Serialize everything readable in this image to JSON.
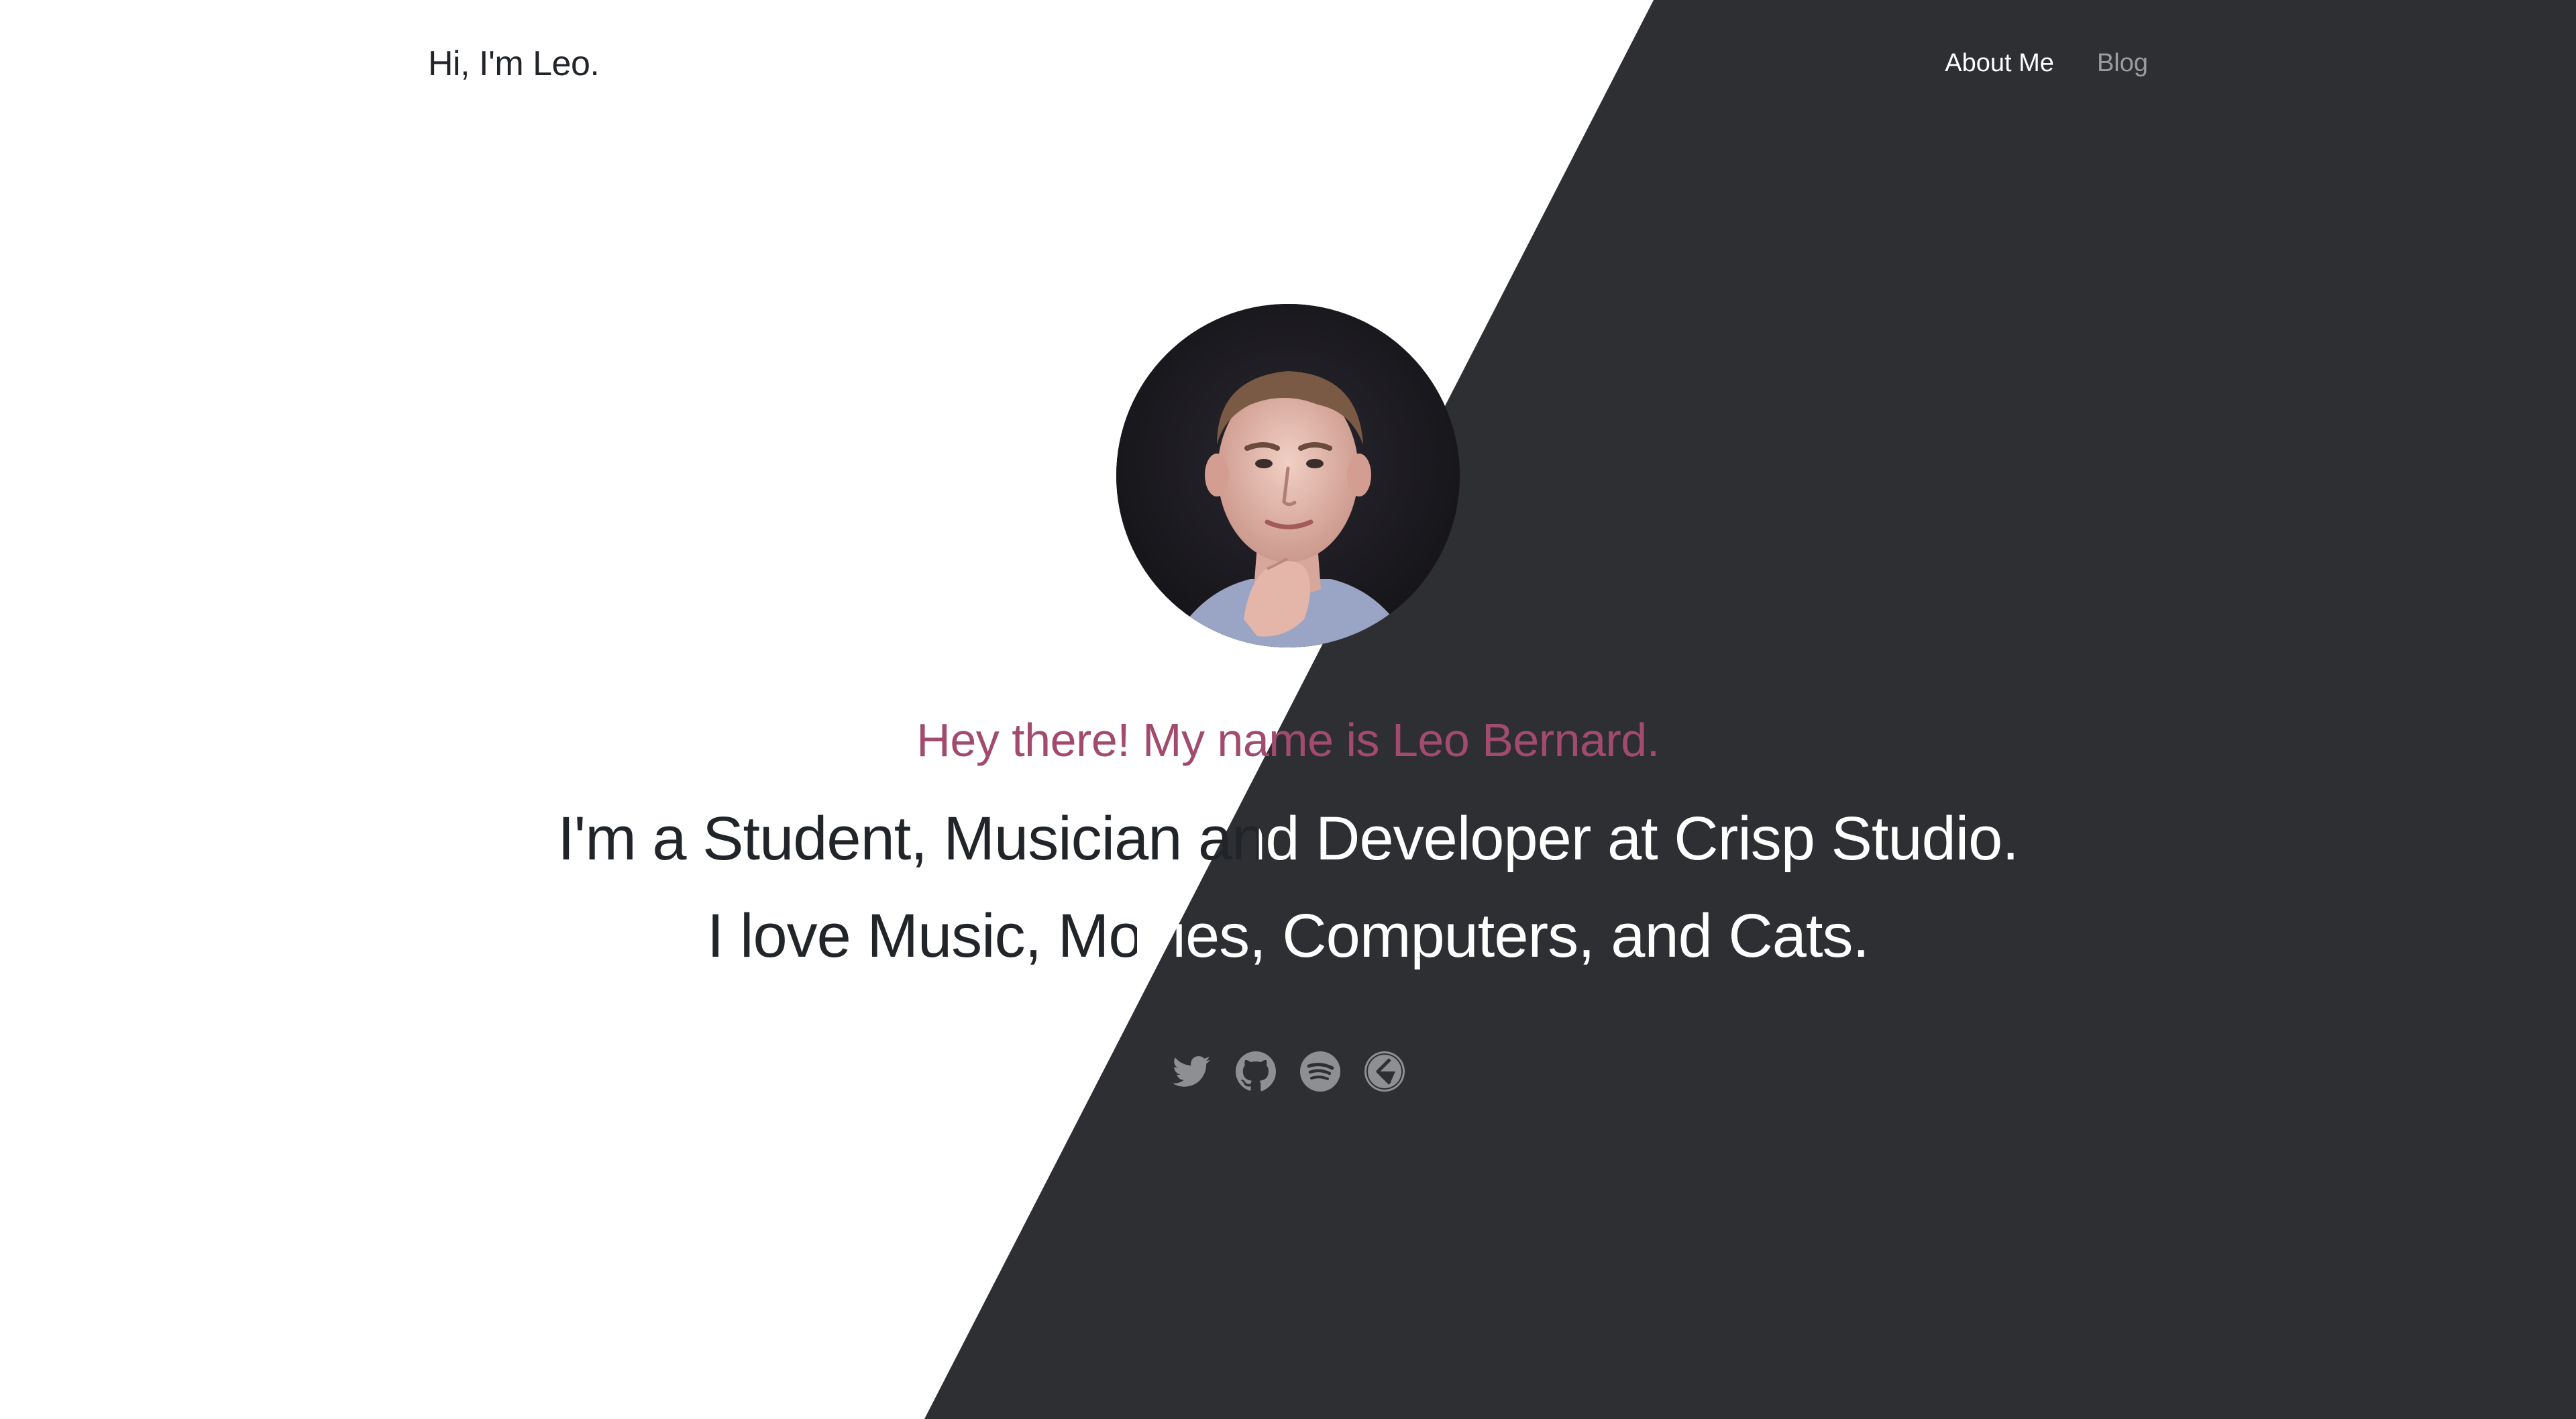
{
  "header": {
    "brand": "Hi, I'm Leo.",
    "nav": [
      {
        "label": "About Me"
      },
      {
        "label": "Blog"
      }
    ]
  },
  "hero": {
    "greeting": "Hey there! My name is Leo Bernard.",
    "line1": "I'm a Student, Musician and Developer at Crisp Studio.",
    "line2": "I love Music, Movies, Computers, and Cats."
  },
  "socials": [
    {
      "icon": "twitter-icon"
    },
    {
      "icon": "github-icon"
    },
    {
      "icon": "spotify-icon"
    },
    {
      "icon": "crisp-studio-icon"
    }
  ],
  "colors": {
    "background": "#ffffff",
    "dark_panel": "#2e2f33",
    "accent": "#a24b6f",
    "text_dark": "#212529",
    "nav_muted": "#9a9ca0"
  }
}
